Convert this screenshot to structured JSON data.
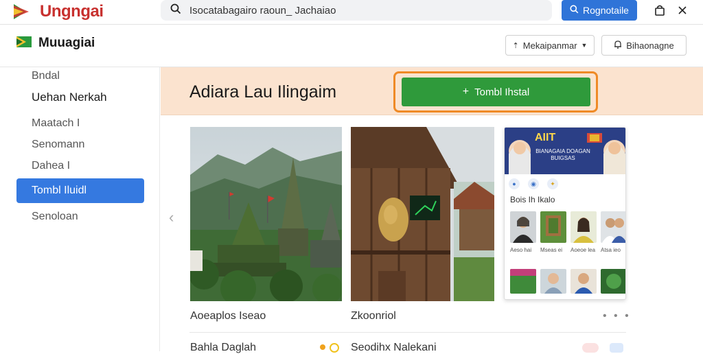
{
  "topbar": {
    "brand": "Ungngai",
    "search_value": "Isocatabagairo raoun_ Jachaiao",
    "register_label": "Rognotaile",
    "icons": [
      "search-icon",
      "bag-icon",
      "close-icon"
    ]
  },
  "header": {
    "brand": "Muuagiai",
    "dropdown_label": "Mekaipanmar",
    "notif_label": "Bihaonagne"
  },
  "sidebar": {
    "items": [
      {
        "label": "Bndal"
      },
      {
        "label": "Uehan Nerkah"
      },
      {
        "label": "Maatach I"
      },
      {
        "label": "Senomann"
      },
      {
        "label": "Dahea I"
      },
      {
        "label": "Tombl Iluidl"
      },
      {
        "label": "Senoloan"
      }
    ]
  },
  "banner": {
    "title": "Adiara Lau Ilingaim",
    "install_label": "Tombl Ihstal"
  },
  "gallery": {
    "captions": [
      "Aoeaplos Iseao",
      "Zkoonriol"
    ],
    "list_labels": [
      "Bahla Daglah",
      "Seodihx Nalekani"
    ]
  },
  "profile_card": {
    "title": "AIIT",
    "subtitle": "BIANAGAIA DOAGAN BUIGSAS",
    "section_label": "Bois Ih Ikalo",
    "thumb_captions": [
      "Aeso hai",
      "Mseas ei",
      "Aoeoe lea",
      "Atsa ieo"
    ]
  },
  "colors": {
    "accent_blue": "#3579e0",
    "install_green": "#2f9a3b",
    "highlight_orange": "#ef8a26",
    "banner_bg": "#fbe3cf",
    "brand_red": "#c8312f"
  }
}
